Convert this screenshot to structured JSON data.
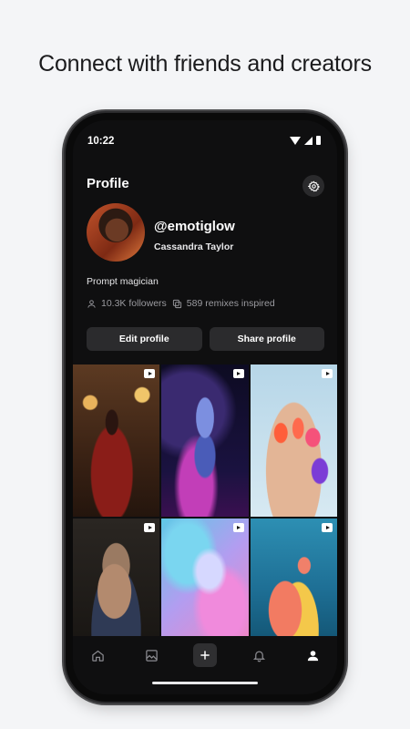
{
  "headline": "Connect with friends and creators",
  "status": {
    "time": "10:22"
  },
  "header": {
    "title": "Profile",
    "settings_icon": "gear-icon"
  },
  "user": {
    "handle": "@emotiglow",
    "name": "Cassandra Taylor",
    "bio": "Prompt magician",
    "followers": "10.3K followers",
    "remixes": "589 remixes inspired"
  },
  "actions": {
    "edit": "Edit profile",
    "share": "Share profile"
  },
  "nav": [
    "home-icon",
    "image-icon",
    "add-icon",
    "bell-icon",
    "profile-icon"
  ],
  "colors": {
    "screen": "#0f0f10",
    "button": "#2b2b2d",
    "page": "#f4f5f7"
  }
}
